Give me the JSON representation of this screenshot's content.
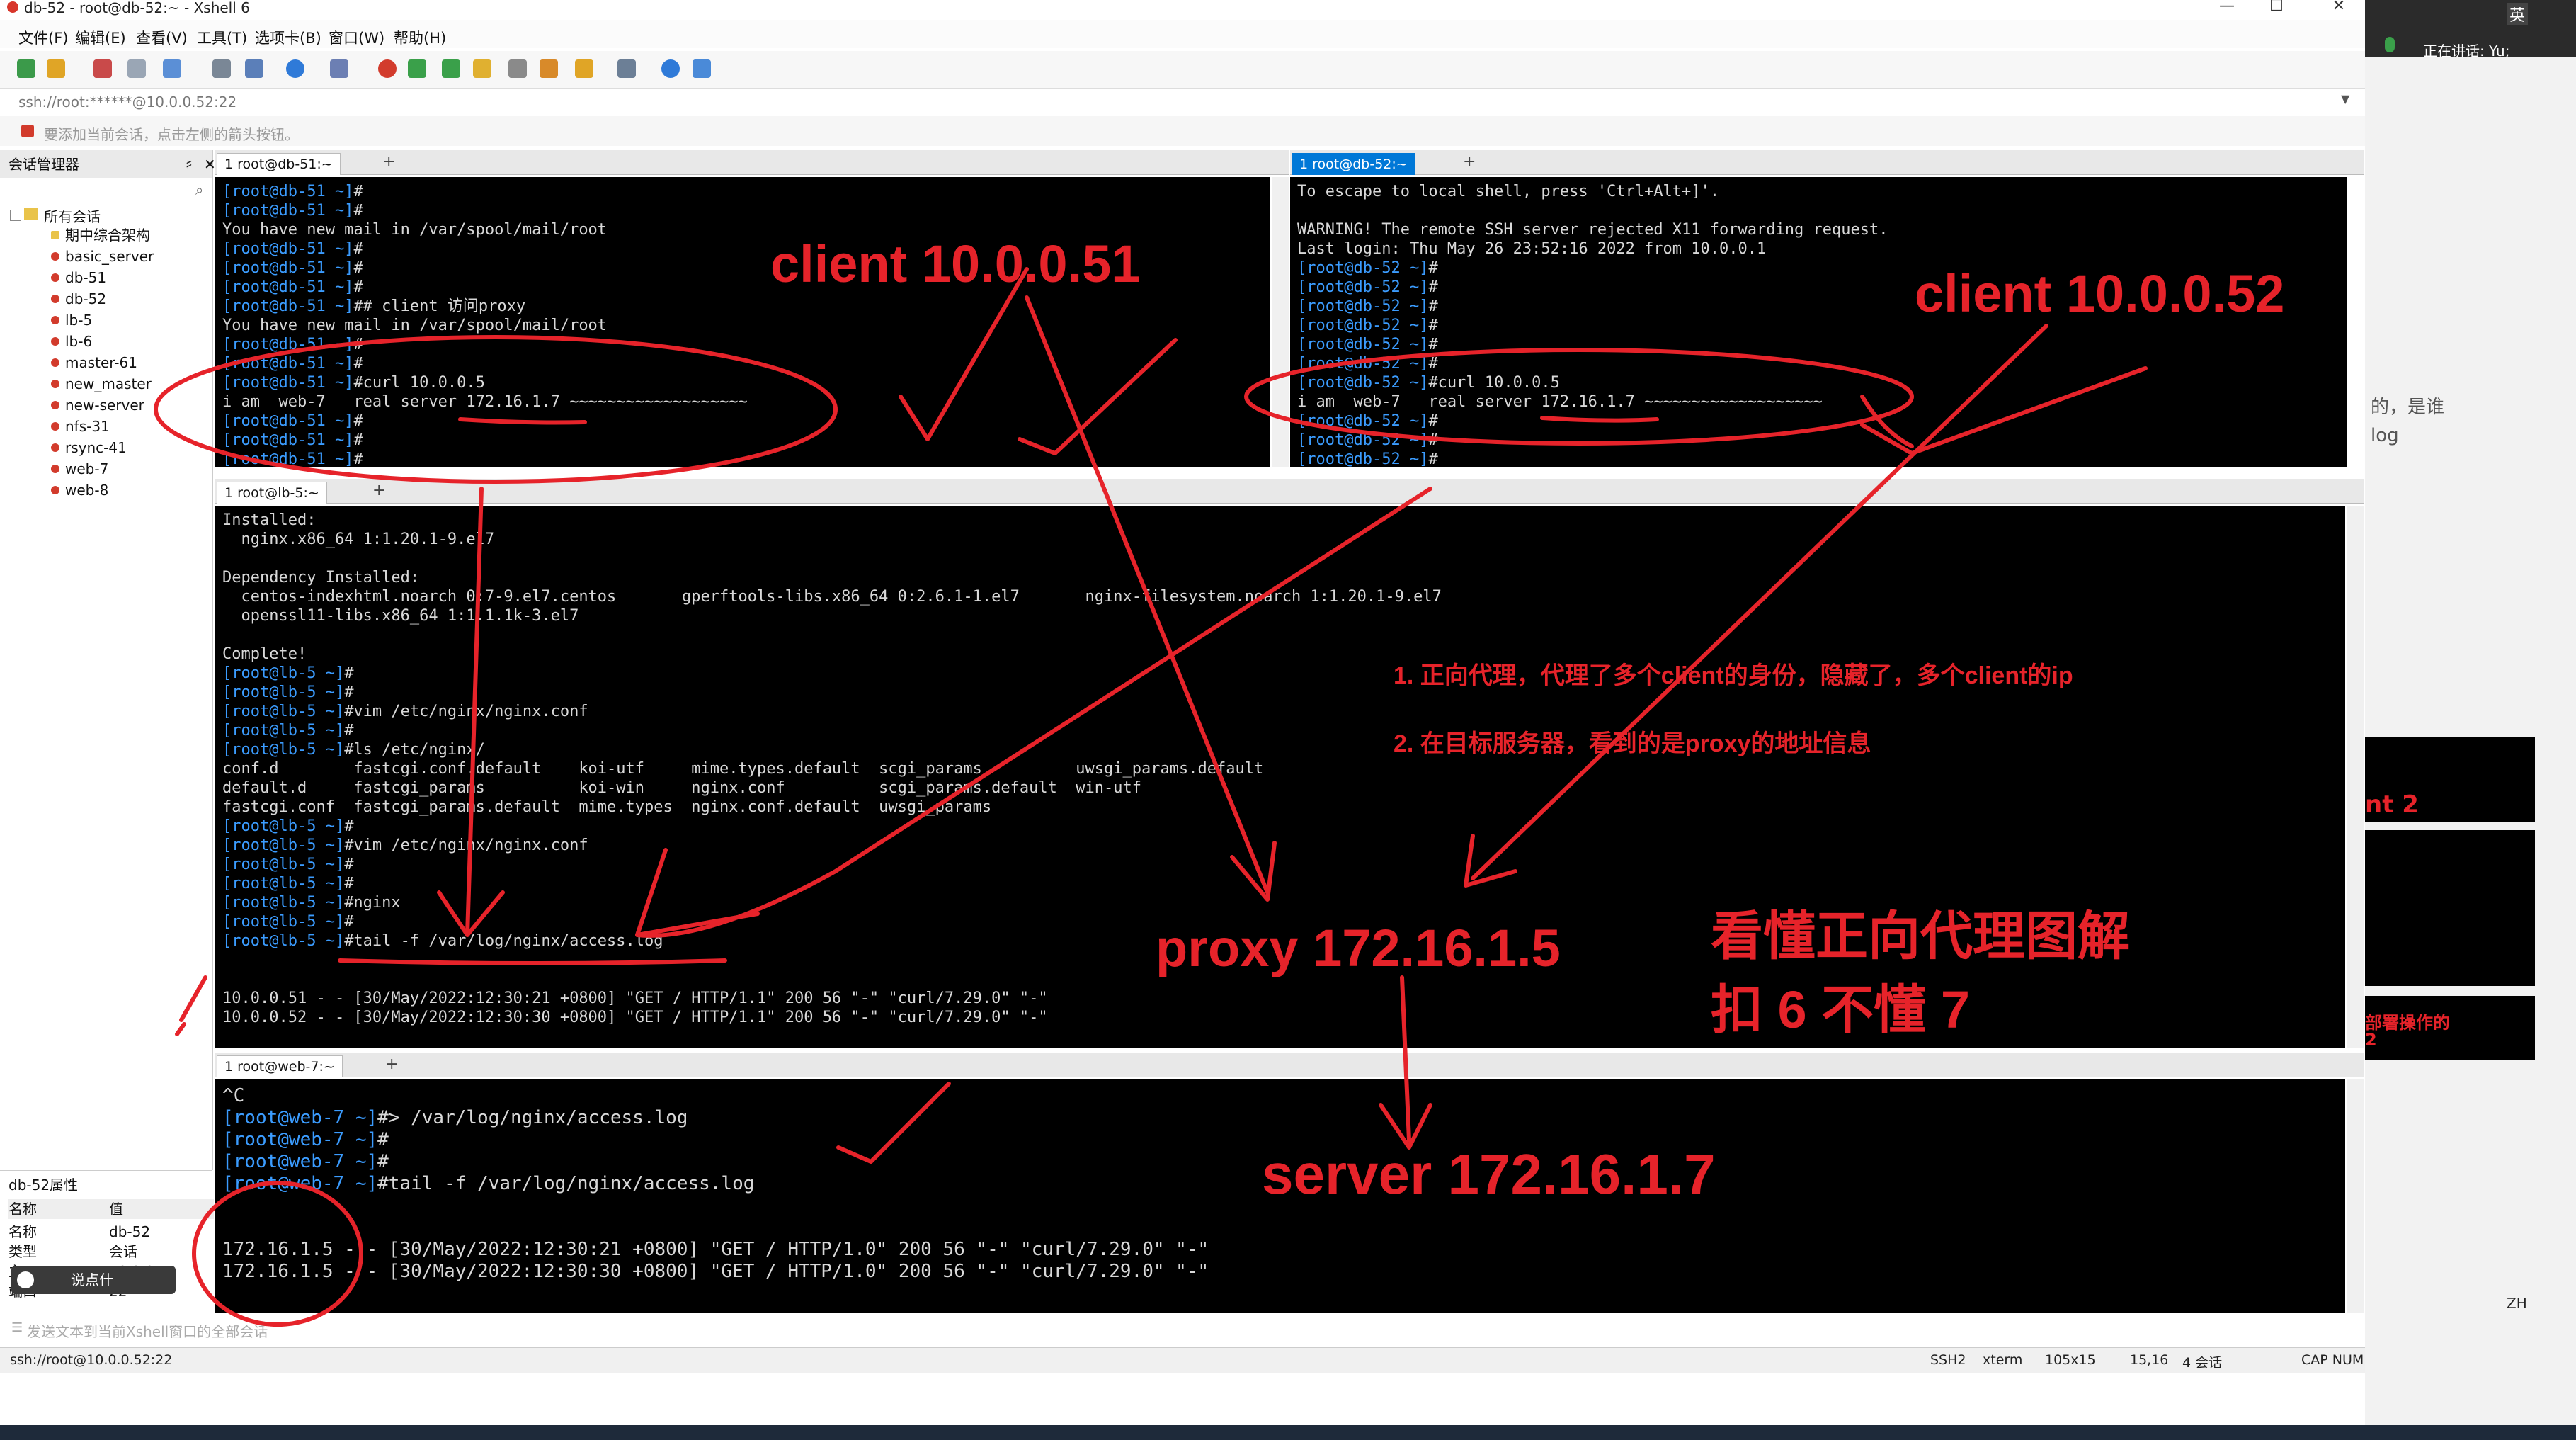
{
  "window": {
    "title": "db-52 - root@db-52:~ - Xshell 6",
    "minimize": "—",
    "maximize": "☐",
    "close": "✕"
  },
  "menu": [
    "文件(F)",
    "编辑(E)",
    "查看(V)",
    "工具(T)",
    "选项卡(B)",
    "窗口(W)",
    "帮助(H)"
  ],
  "address": "ssh://root:******@10.0.0.52:22",
  "hint": "要添加当前会话，点击左侧的箭头按钮。",
  "session_manager": {
    "title": "会话管理器",
    "pin": "♯",
    "close": "✕",
    "root": "所有会话",
    "items": [
      "期中综合架构",
      "basic_server",
      "db-51",
      "db-52",
      "lb-5",
      "lb-6",
      "master-61",
      "new_master",
      "new-server",
      "nfs-31",
      "rsync-41",
      "web-7",
      "web-8"
    ]
  },
  "properties": {
    "title": "db-52属性",
    "col_name": "名称",
    "col_value": "值",
    "rows": [
      [
        "名称",
        "db-52"
      ],
      [
        "类型",
        "会话"
      ],
      [
        "主",
        "10.0.0."
      ],
      [
        "端口",
        "22"
      ]
    ],
    "voice_popup": "说点什"
  },
  "send_text_placeholder": "发送文本到当前Xshell窗口的全部会话",
  "tabs": {
    "db51": "1 root@db-51:~",
    "db52": "1 root@db-52:~",
    "lb5": "1 root@lb-5:~",
    "web7": "1 root@web-7:~",
    "add": "+"
  },
  "term_db51": [
    {
      "p": "[root@db-51 ~]",
      "c": "#"
    },
    {
      "p": "[root@db-51 ~]",
      "c": "#"
    },
    {
      "p": "",
      "c": "You have new mail in /var/spool/mail/root"
    },
    {
      "p": "[root@db-51 ~]",
      "c": "#"
    },
    {
      "p": "[root@db-51 ~]",
      "c": "#"
    },
    {
      "p": "[root@db-51 ~]",
      "c": "#"
    },
    {
      "p": "[root@db-51 ~]",
      "c": "## client 访问proxy"
    },
    {
      "p": "",
      "c": "You have new mail in /var/spool/mail/root"
    },
    {
      "p": "[root@db-51 ~]",
      "c": "#"
    },
    {
      "p": "[root@db-51 ~]",
      "c": "#"
    },
    {
      "p": "[root@db-51 ~]",
      "c": "#curl 10.0.0.5"
    },
    {
      "p": "",
      "c": "i am  web-7   real server 172.16.1.7 ~~~~~~~~~~~~~~~~~~~"
    },
    {
      "p": "[root@db-51 ~]",
      "c": "#"
    },
    {
      "p": "[root@db-51 ~]",
      "c": "#"
    },
    {
      "p": "[root@db-51 ~]",
      "c": "#"
    }
  ],
  "term_db52": [
    {
      "p": "",
      "c": "To escape to local shell, press 'Ctrl+Alt+]'."
    },
    {
      "p": "",
      "c": ""
    },
    {
      "p": "",
      "c": "WARNING! The remote SSH server rejected X11 forwarding request."
    },
    {
      "p": "",
      "c": "Last login: Thu May 26 23:52:16 2022 from 10.0.0.1"
    },
    {
      "p": "[root@db-52 ~]",
      "c": "#"
    },
    {
      "p": "[root@db-52 ~]",
      "c": "#"
    },
    {
      "p": "[root@db-52 ~]",
      "c": "#"
    },
    {
      "p": "[root@db-52 ~]",
      "c": "#"
    },
    {
      "p": "[root@db-52 ~]",
      "c": "#"
    },
    {
      "p": "[root@db-52 ~]",
      "c": "#"
    },
    {
      "p": "[root@db-52 ~]",
      "c": "#curl 10.0.0.5"
    },
    {
      "p": "",
      "c": "i am  web-7   real server 172.16.1.7 ~~~~~~~~~~~~~~~~~~~"
    },
    {
      "p": "[root@db-52 ~]",
      "c": "#"
    },
    {
      "p": "[root@db-52 ~]",
      "c": "#"
    },
    {
      "p": "[root@db-52 ~]",
      "c": "#"
    }
  ],
  "term_lb5": [
    {
      "p": "",
      "c": "Installed:"
    },
    {
      "p": "",
      "c": "  nginx.x86_64 1:1.20.1-9.el7"
    },
    {
      "p": "",
      "c": ""
    },
    {
      "p": "",
      "c": "Dependency Installed:"
    },
    {
      "p": "",
      "c": "  centos-indexhtml.noarch 0:7-9.el7.centos       gperftools-libs.x86_64 0:2.6.1-1.el7       nginx-filesystem.noarch 1:1.20.1-9.el7"
    },
    {
      "p": "",
      "c": "  openssl11-libs.x86_64 1:1.1.1k-3.el7"
    },
    {
      "p": "",
      "c": ""
    },
    {
      "p": "",
      "c": "Complete!"
    },
    {
      "p": "[root@lb-5 ~]",
      "c": "#"
    },
    {
      "p": "[root@lb-5 ~]",
      "c": "#"
    },
    {
      "p": "[root@lb-5 ~]",
      "c": "#vim /etc/nginx/nginx.conf"
    },
    {
      "p": "[root@lb-5 ~]",
      "c": "#"
    },
    {
      "p": "[root@lb-5 ~]",
      "c": "#ls /etc/nginx/"
    },
    {
      "p": "",
      "c": "conf.d        fastcgi.conf.default    koi-utf     mime.types.default  scgi_params          uwsgi_params.default"
    },
    {
      "p": "",
      "c": "default.d     fastcgi_params          koi-win     nginx.conf          scgi_params.default  win-utf"
    },
    {
      "p": "",
      "c": "fastcgi.conf  fastcgi_params.default  mime.types  nginx.conf.default  uwsgi_params"
    },
    {
      "p": "[root@lb-5 ~]",
      "c": "#"
    },
    {
      "p": "[root@lb-5 ~]",
      "c": "#vim /etc/nginx/nginx.conf"
    },
    {
      "p": "[root@lb-5 ~]",
      "c": "#"
    },
    {
      "p": "[root@lb-5 ~]",
      "c": "#"
    },
    {
      "p": "[root@lb-5 ~]",
      "c": "#nginx"
    },
    {
      "p": "[root@lb-5 ~]",
      "c": "#"
    },
    {
      "p": "[root@lb-5 ~]",
      "c": "#tail -f /var/log/nginx/access.log"
    },
    {
      "p": "",
      "c": ""
    },
    {
      "p": "",
      "c": ""
    },
    {
      "p": "",
      "c": "10.0.0.51 - - [30/May/2022:12:30:21 +0800] \"GET / HTTP/1.1\" 200 56 \"-\" \"curl/7.29.0\" \"-\""
    },
    {
      "p": "",
      "c": "10.0.0.52 - - [30/May/2022:12:30:30 +0800] \"GET / HTTP/1.1\" 200 56 \"-\" \"curl/7.29.0\" \"-\""
    }
  ],
  "term_web7": [
    {
      "p": "",
      "c": "^C"
    },
    {
      "p": "[root@web-7 ~]",
      "c": "#> /var/log/nginx/access.log"
    },
    {
      "p": "[root@web-7 ~]",
      "c": "#"
    },
    {
      "p": "[root@web-7 ~]",
      "c": "#"
    },
    {
      "p": "[root@web-7 ~]",
      "c": "#tail -f /var/log/nginx/access.log"
    },
    {
      "p": "",
      "c": ""
    },
    {
      "p": "",
      "c": ""
    },
    {
      "p": "",
      "c": "172.16.1.5 - - [30/May/2022:12:30:21 +0800] \"GET / HTTP/1.0\" 200 56 \"-\" \"curl/7.29.0\" \"-\""
    },
    {
      "p": "",
      "c": "172.16.1.5 - - [30/May/2022:12:30:30 +0800] \"GET / HTTP/1.0\" 200 56 \"-\" \"curl/7.29.0\" \"-\""
    }
  ],
  "status": {
    "connection": "ssh://root@10.0.0.52:22",
    "protocol": "SSH2",
    "term": "xterm",
    "size": "105x15",
    "cursor": "15,16",
    "sessions": "4 会话",
    "caps": "CAP NUM"
  },
  "annotations": {
    "client1": "client  10.0.0.51",
    "client2": "client  10.0.0.52",
    "proxy": "proxy   172.16.1.5",
    "server": "server  172.16.1.7",
    "note1": "1. 正向代理，代理了多个client的身份，隐藏了，多个client的ip",
    "note2": "2. 在目标服务器，看到的是proxy的地址信息",
    "big1": "看懂正向代理图解",
    "big2": "扣 6   不懂 7"
  },
  "right_panel": {
    "lang": "英",
    "speaking": "正在讲话: Yu;",
    "text1": "的，是谁",
    "text2": "log",
    "text3": "nt 2",
    "text4": "部署操作的",
    "text5": "2",
    "ime": "ZH"
  },
  "colors": {
    "annotation": "#e6232a",
    "prompt": "#3b9cff",
    "terminal_bg": "#000000",
    "active_tab": "#0078d7"
  }
}
